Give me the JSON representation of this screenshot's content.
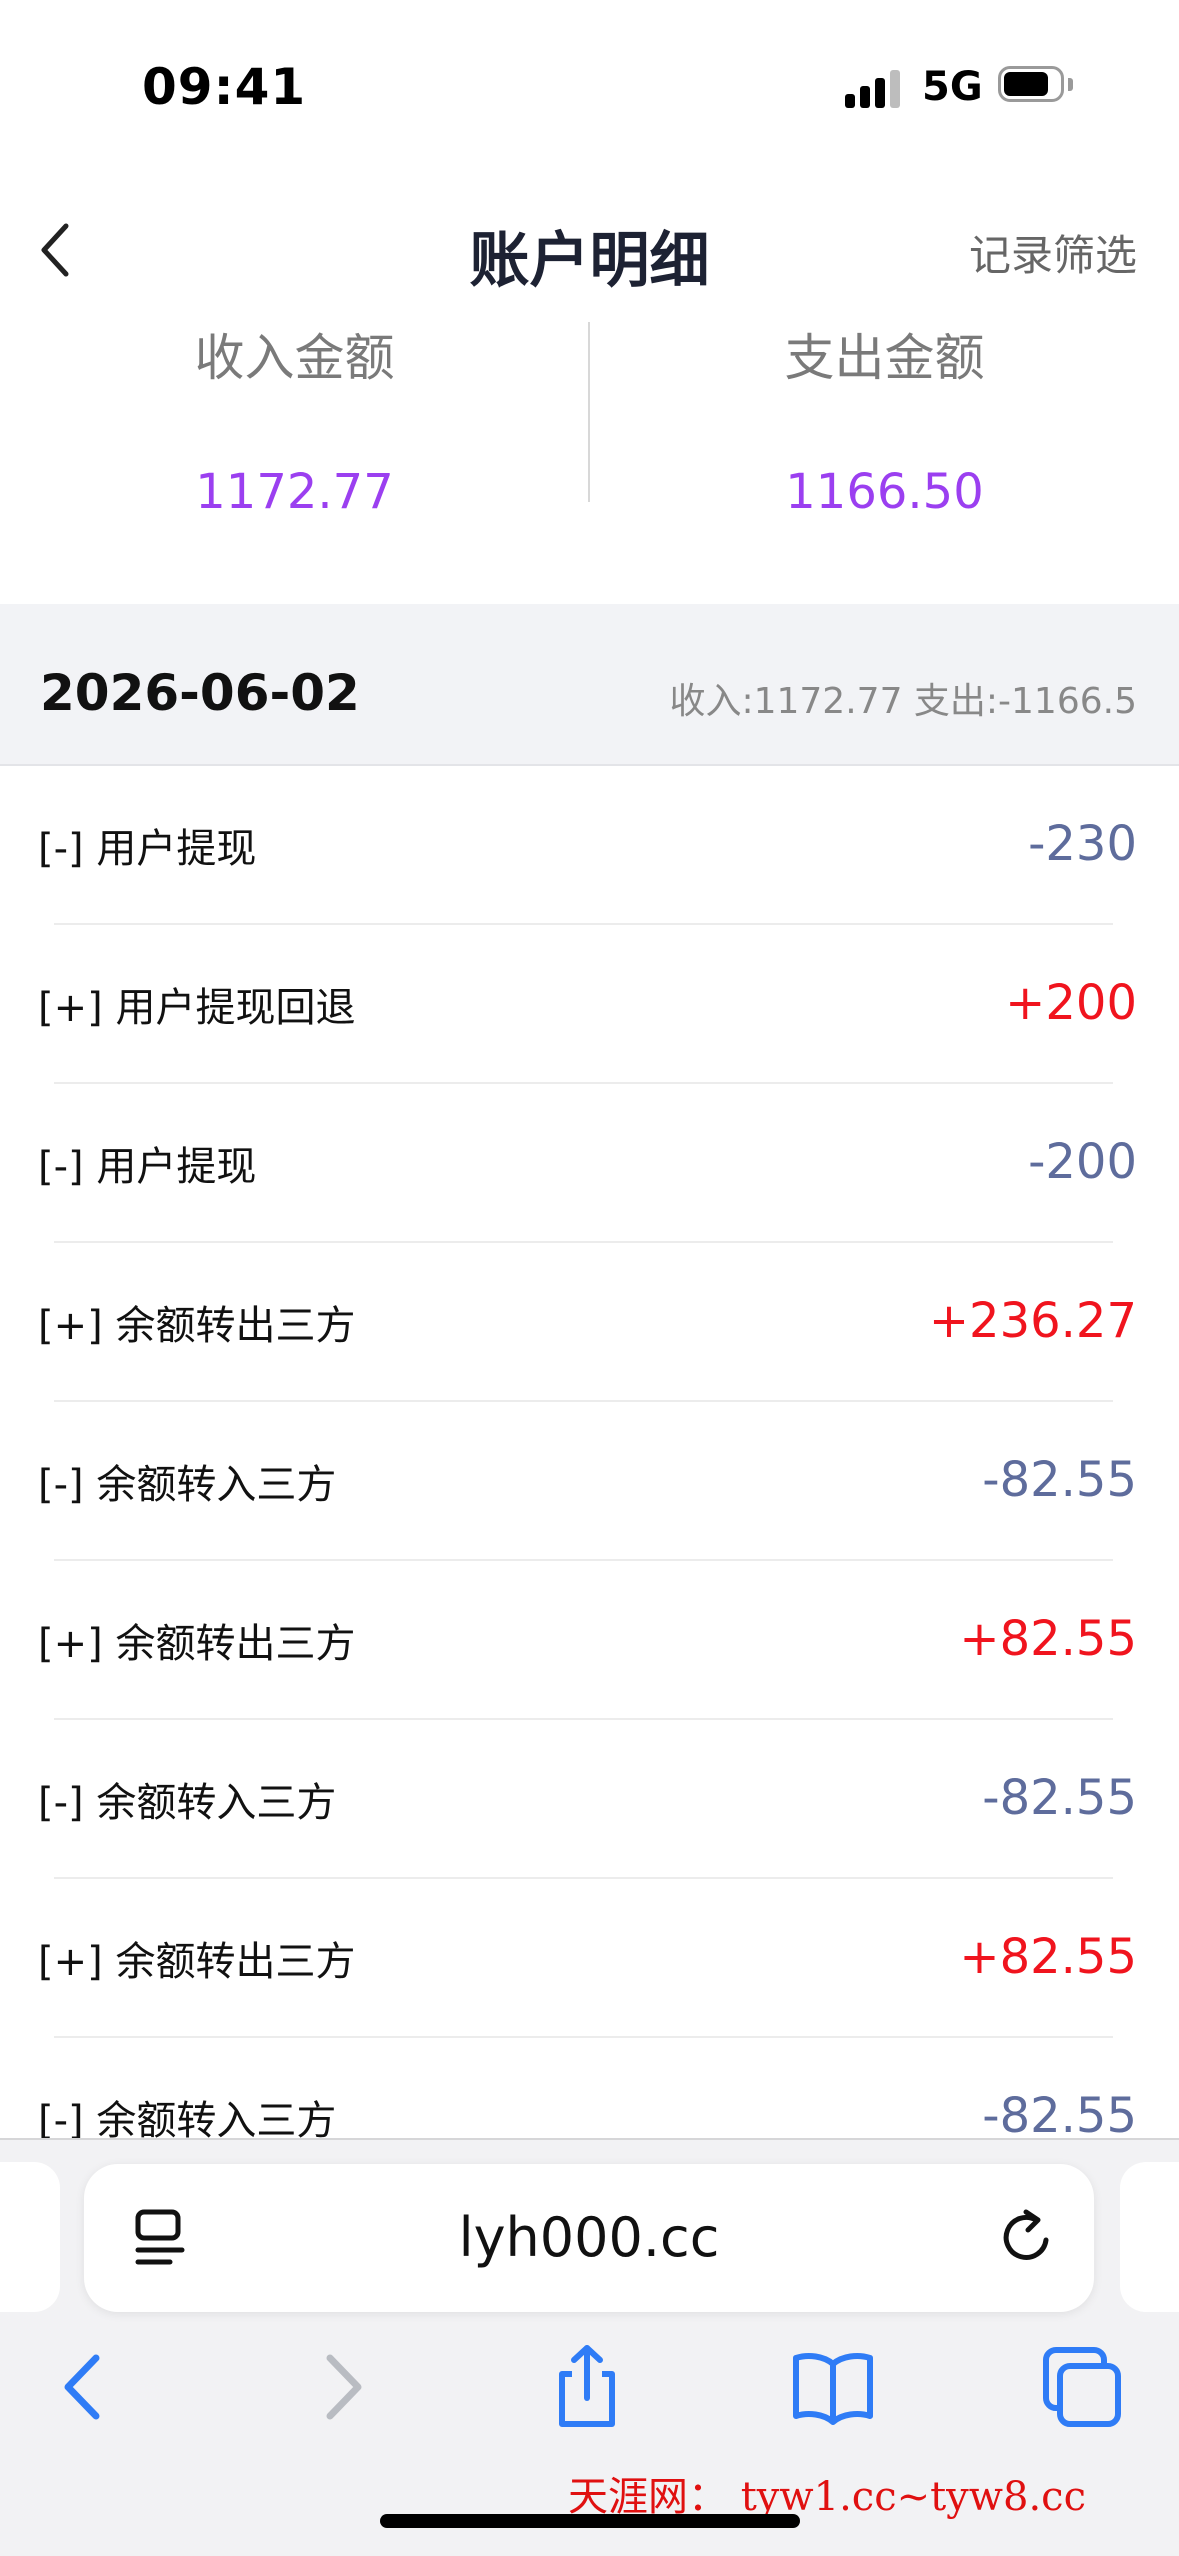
{
  "status_bar": {
    "time": "09:41",
    "network": "5G"
  },
  "header": {
    "title": "账户明细",
    "filter_label": "记录筛选"
  },
  "summary": {
    "income_label": "收入金额",
    "income_value": "1172.77",
    "expense_label": "支出金额",
    "expense_value": "1166.50"
  },
  "date_group": {
    "date": "2026-06-02",
    "summary": "收入:1172.77  支出:-1166.5"
  },
  "transactions": [
    {
      "label": "[-] 用户提现",
      "amount": "-230",
      "type": "expense"
    },
    {
      "label": "[+] 用户提现回退",
      "amount": "+200",
      "type": "income"
    },
    {
      "label": "[-] 用户提现",
      "amount": "-200",
      "type": "expense"
    },
    {
      "label": "[+] 余额转出三方",
      "amount": "+236.27",
      "type": "income"
    },
    {
      "label": "[-] 余额转入三方",
      "amount": "-82.55",
      "type": "expense"
    },
    {
      "label": "[+] 余额转出三方",
      "amount": "+82.55",
      "type": "income"
    },
    {
      "label": "[-] 余额转入三方",
      "amount": "-82.55",
      "type": "expense"
    },
    {
      "label": "[+] 余额转出三方",
      "amount": "+82.55",
      "type": "income"
    },
    {
      "label": "[-] 余额转入三方",
      "amount": "-82.55",
      "type": "expense"
    }
  ],
  "browser": {
    "url": "lyh000.cc"
  },
  "watermark": "天涯网： tyw1.cc~tyw8.cc",
  "colors": {
    "income": "#f0141e",
    "expense": "#5e6c9c",
    "summary_value": "#9b3ff0",
    "toolbar_active": "#2f7cf6"
  },
  "icons": [
    "back-chevron-icon",
    "reader-icon",
    "reload-icon",
    "back-icon",
    "forward-icon",
    "share-icon",
    "bookmarks-icon",
    "tabs-icon"
  ]
}
